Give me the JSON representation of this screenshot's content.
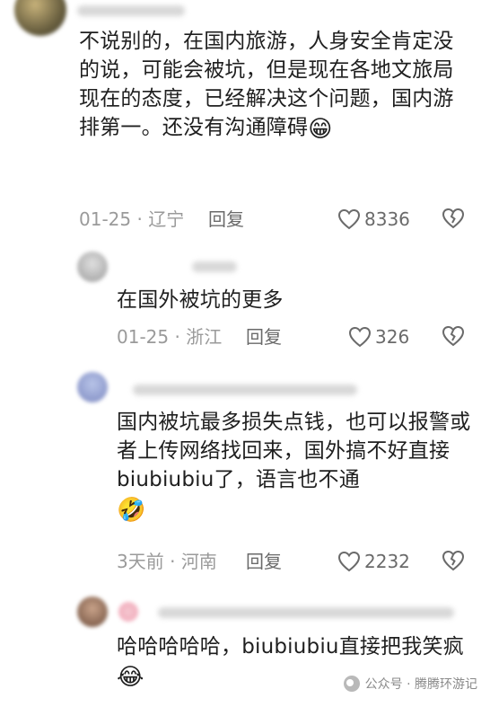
{
  "comments": [
    {
      "text": "不说别的，在国内旅游，人身安全肯定没的说，可能会被坑，但是现在各地文旅局现在的态度，已经解决这个问题，国内游排第一。还没有沟通障碍",
      "emoji": "😁",
      "date": "01-25",
      "location": "辽宁",
      "reply_label": "回复",
      "likes": "8336"
    },
    {
      "text": "在国外被坑的更多",
      "date": "01-25",
      "location": "浙江",
      "reply_label": "回复",
      "likes": "326"
    },
    {
      "text": "国内被坑最多损失点钱，也可以报警或者上传网络找回来，国外搞不好直接biubiubiu了，语言也不通",
      "emoji": "🤣",
      "date": "3天前",
      "location": "河南",
      "reply_label": "回复",
      "likes": "2232"
    },
    {
      "text": "哈哈哈哈哈，biubiubiu直接把我笑疯",
      "emoji": "😂"
    }
  ],
  "watermark": {
    "text": "公众号 · 腾腾环游记"
  },
  "colors": {
    "meta": "#9a9a9a",
    "text": "#1f1f1f",
    "icon": "#6a6a6a"
  },
  "icons": [
    "heart-icon",
    "dislike-icon",
    "wechat-icon"
  ]
}
